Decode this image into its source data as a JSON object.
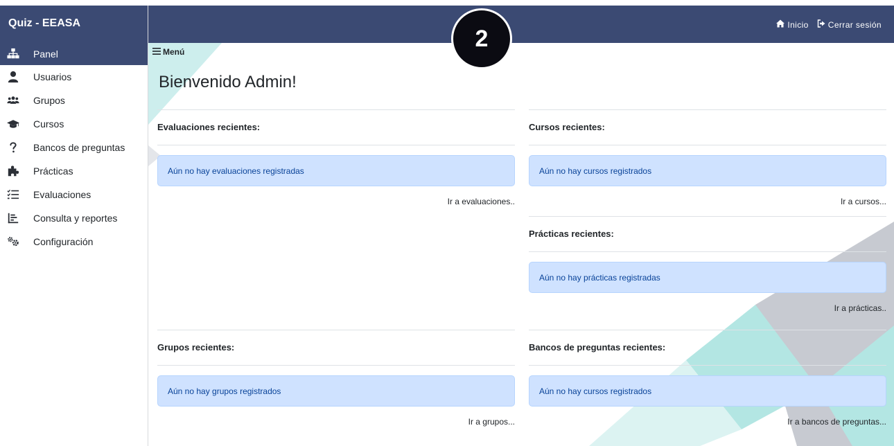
{
  "app": {
    "brand": "Quiz - EEASA"
  },
  "sidebar": {
    "items": [
      {
        "label": "Panel",
        "icon": "sitemap-icon"
      },
      {
        "label": "Usuarios",
        "icon": "user-icon"
      },
      {
        "label": "Grupos",
        "icon": "users-icon"
      },
      {
        "label": "Cursos",
        "icon": "graduation-cap-icon"
      },
      {
        "label": "Bancos de preguntas",
        "icon": "question-icon"
      },
      {
        "label": "Prácticas",
        "icon": "puzzle-icon"
      },
      {
        "label": "Evaluaciones",
        "icon": "list-check-icon"
      },
      {
        "label": "Consulta y reportes",
        "icon": "chart-icon"
      },
      {
        "label": "Configuración",
        "icon": "gears-icon"
      }
    ]
  },
  "topbar": {
    "home": "Inicio",
    "logout": "Cerrar sesión"
  },
  "overlay": {
    "step": "2"
  },
  "main": {
    "menu": "Menú",
    "title": "Bienvenido Admin!",
    "sections": {
      "evaluaciones": {
        "title": "Evaluaciones recientes:",
        "empty": "Aún no hay evaluaciones registradas",
        "link": "Ir a evaluaciones.."
      },
      "cursos": {
        "title": "Cursos recientes:",
        "empty": "Aún no hay cursos registrados",
        "link": "Ir a cursos..."
      },
      "practicas": {
        "title": "Prácticas recientes:",
        "empty": "Aún no hay prácticas registradas",
        "link": "Ir a prácticas.."
      },
      "grupos": {
        "title": "Grupos recientes:",
        "empty": "Aún no hay grupos registrados",
        "link": "Ir a grupos..."
      },
      "bancos": {
        "title": "Bancos de preguntas recientes:",
        "empty": "Aún no hay cursos registrados",
        "link": "Ir a bancos de preguntas..."
      }
    }
  },
  "colors": {
    "navy": "#3b4a73",
    "alert_bg": "#cfe2ff",
    "alert_text": "#084298",
    "teal": "#b3e6e3",
    "slate": "#c7cad1"
  }
}
